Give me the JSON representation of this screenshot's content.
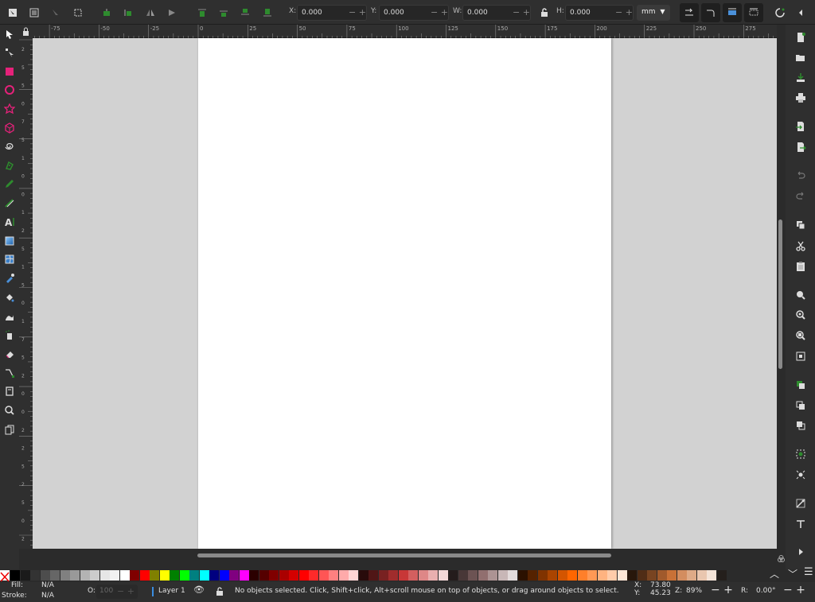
{
  "toolbar": {
    "x_label": "X:",
    "x_value": "0.000",
    "y_label": "Y:",
    "y_value": "0.000",
    "w_label": "W:",
    "w_value": "0.000",
    "h_label": "H:",
    "h_value": "0.000",
    "unit": "mm"
  },
  "ruler": {
    "h_ticks": [
      "-75",
      "-50",
      "-25",
      "0",
      "25",
      "50",
      "75",
      "100",
      "125",
      "150",
      "175",
      "200",
      "225",
      "250",
      "275"
    ],
    "v_ticks": [
      "2",
      "5",
      "5",
      "0",
      "7",
      "5",
      "1",
      "0",
      "0",
      "1",
      "2",
      "5",
      "1",
      "5",
      "0",
      "1",
      "7",
      "5",
      "2",
      "0",
      "0",
      "2",
      "2",
      "5",
      "2",
      "5",
      "0",
      "2"
    ]
  },
  "palette": {
    "colors": [
      "#000000",
      "#1a1a1a",
      "#333333",
      "#4d4d4d",
      "#666666",
      "#808080",
      "#999999",
      "#b3b3b3",
      "#cccccc",
      "#e6e6e6",
      "#f2f2f2",
      "#ffffff",
      "#800000",
      "#ff0000",
      "#808000",
      "#ffff00",
      "#008000",
      "#00ff00",
      "#008080",
      "#00ffff",
      "#000080",
      "#0000ff",
      "#800080",
      "#ff00ff",
      "#2b0000",
      "#550000",
      "#800000",
      "#aa0000",
      "#d40000",
      "#ff0000",
      "#ff2a2a",
      "#ff5555",
      "#ff8080",
      "#ffaaaa",
      "#ffd5d5",
      "#280b0b",
      "#501616",
      "#782121",
      "#a02c2c",
      "#c83737",
      "#d35f5f",
      "#de8787",
      "#e9afaf",
      "#f4d7d7",
      "#241c1c",
      "#483737",
      "#6c5353",
      "#916f6f",
      "#ac9393",
      "#c8b7b7",
      "#e3dbdb",
      "#2b1100",
      "#552200",
      "#803300",
      "#aa4400",
      "#d45500",
      "#ff6600",
      "#ff7f2a",
      "#ff9955",
      "#ffb380",
      "#ffccaa",
      "#ffe6d5",
      "#28170b",
      "#502d16",
      "#784421",
      "#a05a2c",
      "#c87137",
      "#d38d5f",
      "#deaa87",
      "#e9c6af",
      "#f4e3d7",
      "#241f1c"
    ]
  },
  "status": {
    "fill_label": "Fill:",
    "fill_value": "N/A",
    "stroke_label": "Stroke:",
    "stroke_value": "N/A",
    "opacity_label": "O:",
    "opacity_value": "100",
    "layer": "Layer 1",
    "message": "No objects selected. Click, Shift+click, Alt+scroll mouse on top of objects, or drag around objects to select.",
    "cursor_x_label": "X:",
    "cursor_x": "73.80",
    "cursor_y_label": "Y:",
    "cursor_y": "45.23",
    "zoom_label": "Z:",
    "zoom": "89%",
    "rotation_label": "R:",
    "rotation": "0.00°"
  }
}
